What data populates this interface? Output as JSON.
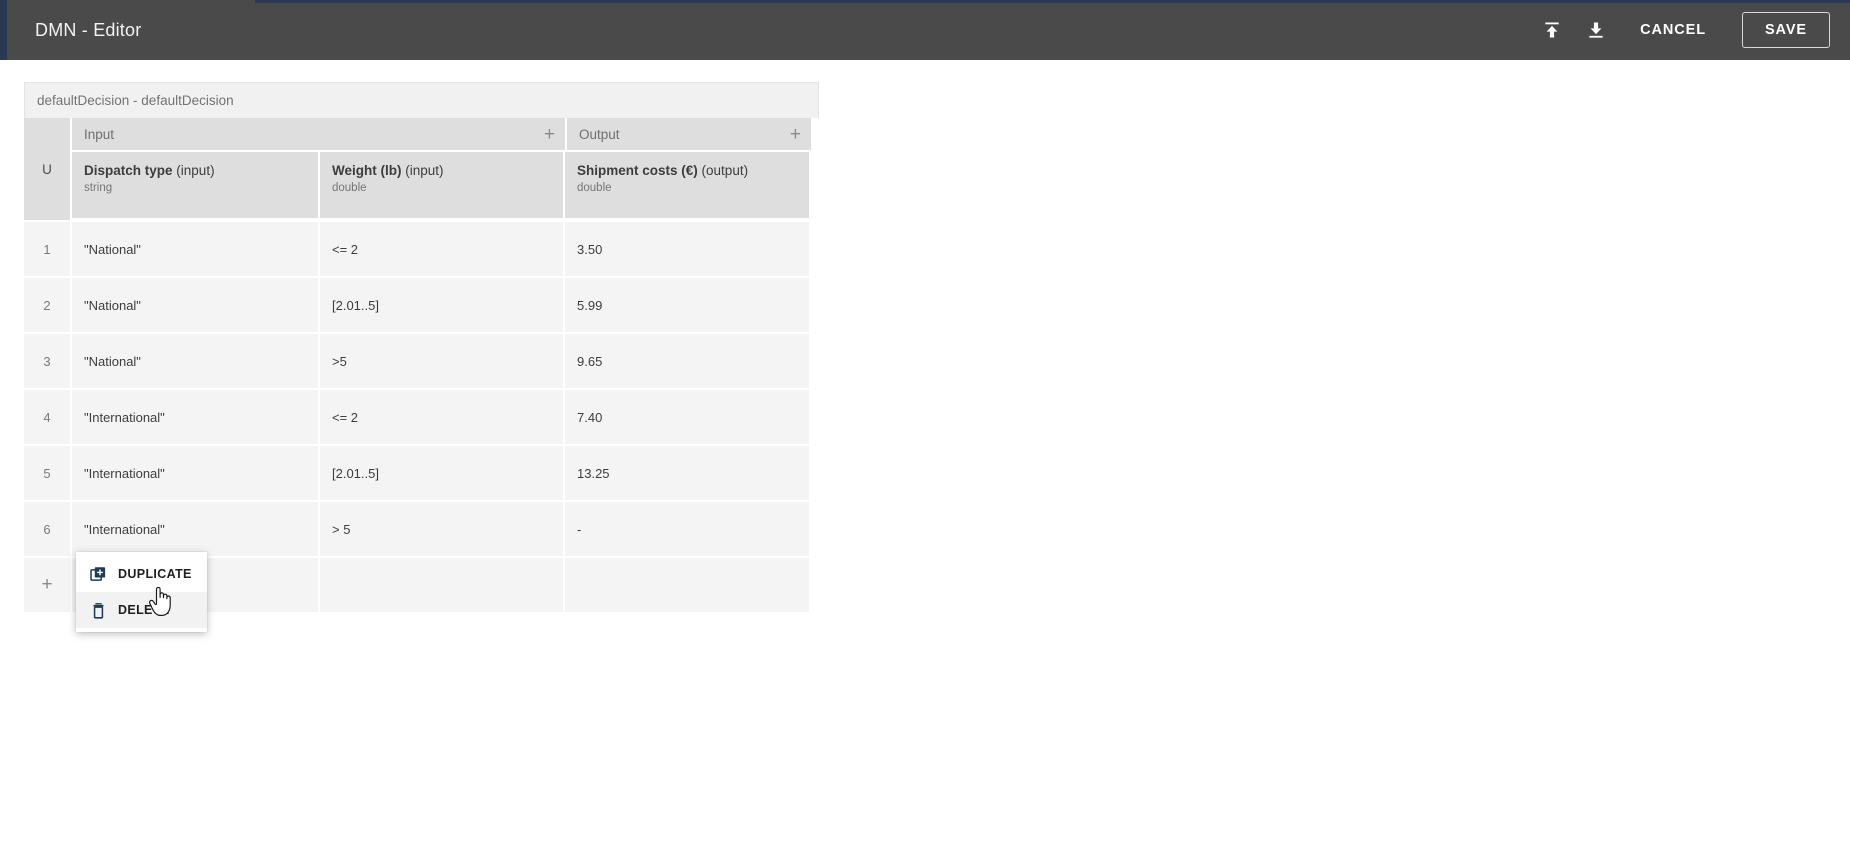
{
  "header": {
    "title": "DMN - Editor",
    "icons": [
      {
        "name": "upload-icon",
        "label": "Upload"
      },
      {
        "name": "download-icon",
        "label": "Download"
      }
    ],
    "cancel_label": "CANCEL",
    "save_label": "SAVE",
    "background_color": "#4a4a4a",
    "accent_color": "#273a52"
  },
  "table": {
    "caption": "defaultDecision - defaultDecision",
    "hit_policy": "U",
    "groups": [
      {
        "label": "Input",
        "add_label": "+"
      },
      {
        "label": "Output",
        "add_label": "+"
      }
    ],
    "columns": [
      {
        "name": "Dispatch type",
        "suffix": "(input)",
        "type": "string"
      },
      {
        "name": "Weight (lb)",
        "suffix": "(input)",
        "type": "double"
      },
      {
        "name": "Shipment costs (€)",
        "suffix": "(output)",
        "type": "double"
      }
    ],
    "rows": [
      {
        "index": "1",
        "dispatch": "\"National\"",
        "weight": "<= 2",
        "cost": "3.50"
      },
      {
        "index": "2",
        "dispatch": "\"National\"",
        "weight": "[2.01..5]",
        "cost": "5.99"
      },
      {
        "index": "3",
        "dispatch": "\"National\"",
        "weight": ">5",
        "cost": "9.65"
      },
      {
        "index": "4",
        "dispatch": "\"International\"",
        "weight": "<= 2",
        "cost": "7.40"
      },
      {
        "index": "5",
        "dispatch": "\"International\"",
        "weight": "[2.01..5]",
        "cost": "13.25"
      },
      {
        "index": "6",
        "dispatch": "\"International\"",
        "weight": "> 5",
        "cost": "-"
      }
    ],
    "add_row_label": "+"
  },
  "context_menu": {
    "items": [
      {
        "label": "DUPLICATE",
        "icon": "duplicate-icon",
        "hovered": false
      },
      {
        "label": "DELETE",
        "icon": "trash-icon",
        "hovered": true
      }
    ],
    "icon_color": "#1f3a5f"
  }
}
